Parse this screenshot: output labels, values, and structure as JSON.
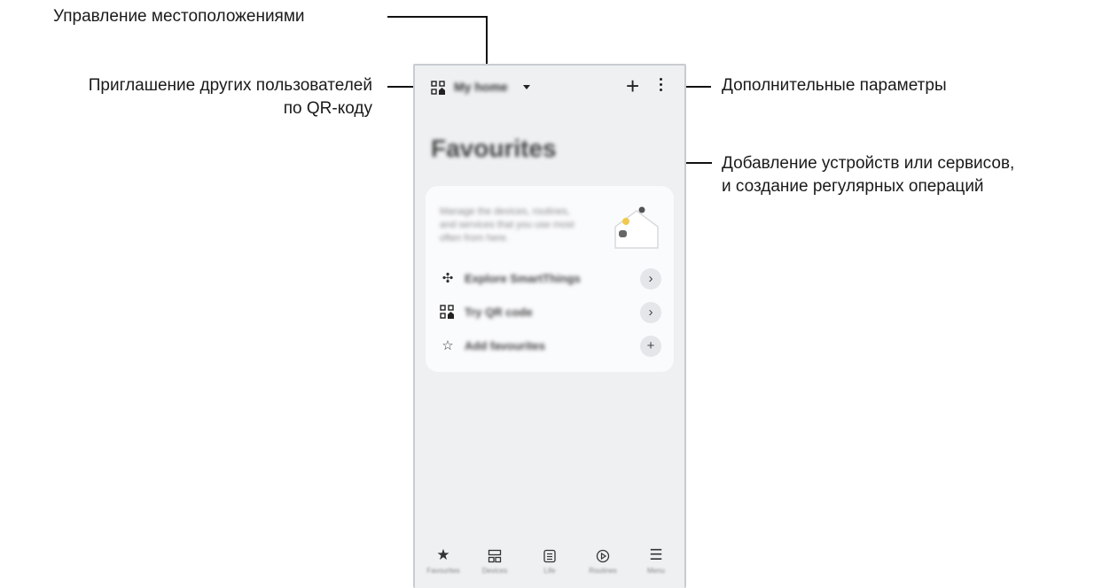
{
  "callouts": {
    "locations": "Управление местоположениями",
    "invite_line1": "Приглашение других пользователей",
    "invite_line2": "по QR-коду",
    "more_options": "Дополнительные параметры",
    "add_line1": "Добавление устройств или сервисов,",
    "add_line2": "и создание регулярных операций"
  },
  "app": {
    "home_name": "My home",
    "favourites_title": "Favourites",
    "card_text": "Manage the devices, routines, and services that you use most often from here.",
    "rows": [
      {
        "icon": "smartthings-icon",
        "label": "Explore SmartThings",
        "action": "chevron-right-icon"
      },
      {
        "icon": "qr-home-icon",
        "label": "Try QR code",
        "action": "chevron-right-icon"
      },
      {
        "icon": "star-outline-icon",
        "label": "Add favourites",
        "action": "plus-icon"
      }
    ],
    "nav": [
      {
        "icon": "star-icon",
        "label": "Favourites"
      },
      {
        "icon": "devices-icon",
        "label": "Devices"
      },
      {
        "icon": "life-icon",
        "label": "Life"
      },
      {
        "icon": "routines-icon",
        "label": "Routines"
      },
      {
        "icon": "menu-icon",
        "label": "Menu"
      }
    ]
  }
}
